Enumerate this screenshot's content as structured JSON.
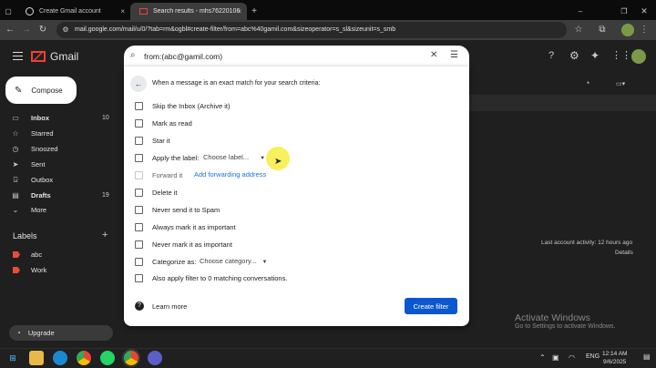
{
  "browser": {
    "tabs": [
      {
        "title": "Create Gmail account",
        "close": "×"
      },
      {
        "title": "Search results - mhs76220106…",
        "close": "×"
      }
    ],
    "new_tab": "+",
    "url": "mail.google.com/mail/u/0/?tab=rm&ogbl#create-filter/from=abc%40gamil.com&sizeoperator=s_sl&sizeunit=s_smb"
  },
  "gmail": {
    "brand": "Gmail",
    "compose_label": "Compose",
    "nav": [
      {
        "label": "Inbox",
        "count": "10",
        "bold": true
      },
      {
        "label": "Starred",
        "count": "",
        "bold": false
      },
      {
        "label": "Snoozed",
        "count": "",
        "bold": false
      },
      {
        "label": "Sent",
        "count": "",
        "bold": false
      },
      {
        "label": "Outbox",
        "count": "",
        "bold": false
      },
      {
        "label": "Drafts",
        "count": "19",
        "bold": true
      },
      {
        "label": "More",
        "count": "",
        "bold": false
      }
    ],
    "labels_header": "Labels",
    "labels": [
      {
        "name": "abc",
        "color": "#e74c3c"
      },
      {
        "name": "Work",
        "color": "#e74c3c"
      }
    ],
    "upgrade_label": "Upgrade"
  },
  "search": {
    "query": "from:(abc@gamil.com)"
  },
  "filter": {
    "header": "When a message is an exact match for your search criteria:",
    "options": [
      {
        "label": "Skip the Inbox (Archive it)",
        "disabled": false
      },
      {
        "label": "Mark as read",
        "disabled": false
      },
      {
        "label": "Star it",
        "disabled": false
      },
      {
        "label": "Apply the label:",
        "disabled": false
      },
      {
        "label": "Forward it",
        "disabled": true
      },
      {
        "label": "Delete it",
        "disabled": false
      },
      {
        "label": "Never send it to Spam",
        "disabled": false
      },
      {
        "label": "Always mark it as important",
        "disabled": false
      },
      {
        "label": "Never mark it as important",
        "disabled": false
      },
      {
        "label": "Categorize as:",
        "disabled": false
      },
      {
        "label": "Also apply filter to 0 matching conversations.",
        "disabled": false
      }
    ],
    "choose_label": "Choose label...",
    "forwarding_link": "Add forwarding address",
    "choose_category": "Choose category...",
    "learn_more": "Learn more",
    "create_filter": "Create filter"
  },
  "account_activity": {
    "text": "Last account activity: 12 hours ago",
    "details": "Details"
  },
  "watermark": {
    "title": "Activate Windows",
    "subtitle": "Go to Settings to activate Windows."
  },
  "taskbar": {
    "lang": "ENG",
    "time": "12:14 AM",
    "date": "9/6/2025"
  }
}
